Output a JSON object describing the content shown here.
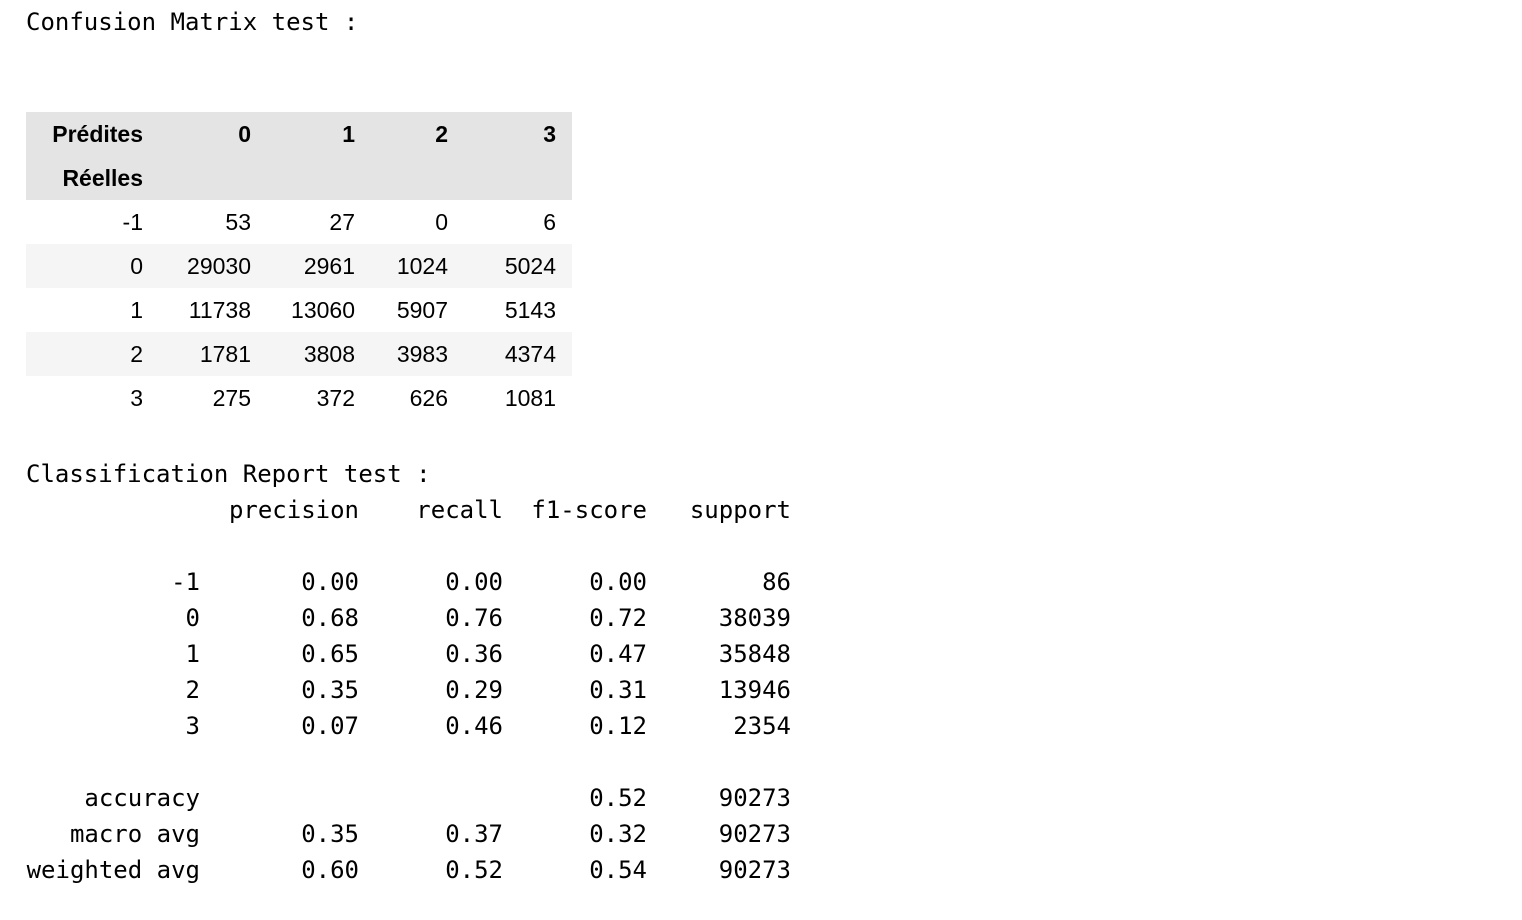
{
  "confusion_title": "Confusion Matrix test :",
  "confusion_matrix": {
    "columns_label": "Prédites",
    "index_label": "Réelles",
    "columns": [
      "0",
      "1",
      "2",
      "3"
    ],
    "rows": [
      {
        "label": "-1",
        "values": [
          "53",
          "27",
          "0",
          "6"
        ]
      },
      {
        "label": "0",
        "values": [
          "29030",
          "2961",
          "1024",
          "5024"
        ]
      },
      {
        "label": "1",
        "values": [
          "11738",
          "13060",
          "5907",
          "5143"
        ]
      },
      {
        "label": "2",
        "values": [
          "1781",
          "3808",
          "3983",
          "4374"
        ]
      },
      {
        "label": "3",
        "values": [
          "275",
          "372",
          "626",
          "1081"
        ]
      }
    ]
  },
  "report_title": "Classification Report test :",
  "report": {
    "headers": [
      "precision",
      "recall",
      "f1-score",
      "support"
    ],
    "class_rows": [
      {
        "label": "-1",
        "precision": "0.00",
        "recall": "0.00",
        "f1": "0.00",
        "support": "86"
      },
      {
        "label": "0",
        "precision": "0.68",
        "recall": "0.76",
        "f1": "0.72",
        "support": "38039"
      },
      {
        "label": "1",
        "precision": "0.65",
        "recall": "0.36",
        "f1": "0.47",
        "support": "35848"
      },
      {
        "label": "2",
        "precision": "0.35",
        "recall": "0.29",
        "f1": "0.31",
        "support": "13946"
      },
      {
        "label": "3",
        "precision": "0.07",
        "recall": "0.46",
        "f1": "0.12",
        "support": "2354"
      }
    ],
    "summary_rows": [
      {
        "label": "accuracy",
        "precision": "",
        "recall": "",
        "f1": "0.52",
        "support": "90273"
      },
      {
        "label": "macro avg",
        "precision": "0.35",
        "recall": "0.37",
        "f1": "0.32",
        "support": "90273"
      },
      {
        "label": "weighted avg",
        "precision": "0.60",
        "recall": "0.52",
        "f1": "0.54",
        "support": "90273"
      }
    ]
  }
}
